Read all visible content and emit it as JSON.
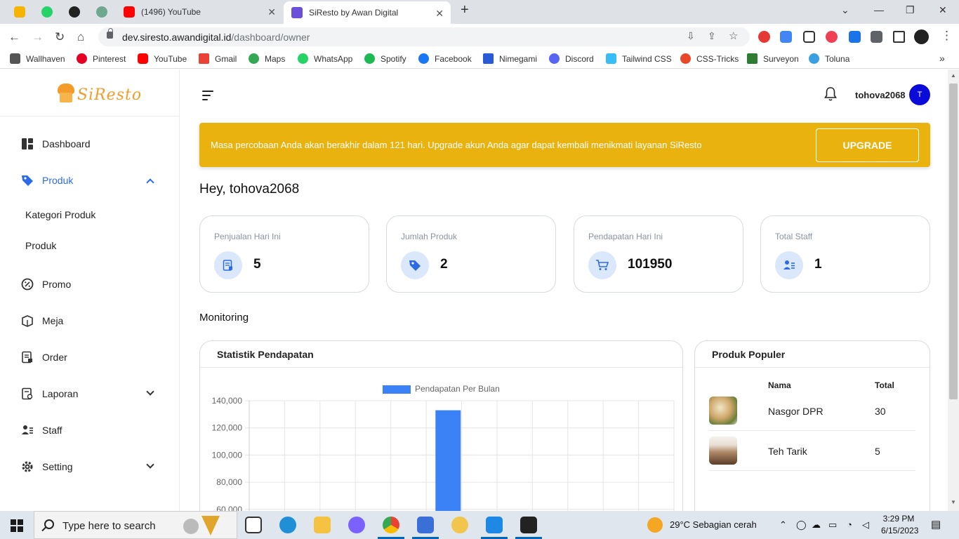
{
  "browser": {
    "tabs": [
      {
        "label": "(1496) YouTube",
        "favicon_color": "#ff0000"
      },
      {
        "label": "SiResto by Awan Digital",
        "favicon_color": "#6b4fd8",
        "active": true
      }
    ],
    "url_host": "dev.siresto.awandigital.id",
    "url_path": "/dashboard/owner",
    "bookmarks": [
      {
        "label": "Wallhaven",
        "icon": "wallhaven-icon",
        "color": "#555555"
      },
      {
        "label": "Pinterest",
        "icon": "pinterest-icon",
        "color": "#e60023"
      },
      {
        "label": "YouTube",
        "icon": "youtube-icon",
        "color": "#ff0000"
      },
      {
        "label": "Gmail",
        "icon": "gmail-icon",
        "color": "#ea4335"
      },
      {
        "label": "Maps",
        "icon": "maps-icon",
        "color": "#34a853"
      },
      {
        "label": "WhatsApp",
        "icon": "whatsapp-icon",
        "color": "#25d366"
      },
      {
        "label": "Spotify",
        "icon": "spotify-icon",
        "color": "#1db954"
      },
      {
        "label": "Facebook",
        "icon": "facebook-icon",
        "color": "#1877f2"
      },
      {
        "label": "Nimegami",
        "icon": "nimegami-icon",
        "color": "#2a5bd7"
      },
      {
        "label": "Discord",
        "icon": "discord-icon",
        "color": "#5865f2"
      },
      {
        "label": "Tailwind CSS",
        "icon": "tailwind-icon",
        "color": "#38bdf8"
      },
      {
        "label": "CSS-Tricks",
        "icon": "css-tricks-icon",
        "color": "#e8472a"
      },
      {
        "label": "Surveyon",
        "icon": "surveyon-icon",
        "color": "#2e7d32"
      },
      {
        "label": "Toluna",
        "icon": "toluna-icon",
        "color": "#3aa0e0"
      }
    ]
  },
  "app": {
    "brand": "SiResto",
    "sidebar": {
      "items": [
        {
          "label": "Dashboard",
          "icon": "dashboard-icon"
        },
        {
          "label": "Produk",
          "icon": "tag-icon",
          "active": true
        },
        {
          "label": "Kategori Produk"
        },
        {
          "label": "Produk"
        },
        {
          "label": "Promo",
          "icon": "percent-icon"
        },
        {
          "label": "Meja",
          "icon": "table-icon"
        },
        {
          "label": "Order",
          "icon": "order-icon"
        },
        {
          "label": "Laporan",
          "icon": "report-icon"
        },
        {
          "label": "Staff",
          "icon": "staff-icon"
        },
        {
          "label": "Setting",
          "icon": "gear-icon"
        }
      ]
    },
    "header": {
      "username": "tohova2068",
      "avatar_initial": "T"
    },
    "banner": {
      "message": "Masa percobaan Anda akan berakhir dalam 121 hari. Upgrade akun Anda agar dapat kembali menikmati layanan SiResto",
      "button": "UPGRADE",
      "color": "#eab20f"
    },
    "greeting": "Hey, tohova2068",
    "stats": [
      {
        "title": "Penjualan Hari Ini",
        "value": "5",
        "icon": "receipt-icon"
      },
      {
        "title": "Jumlah Produk",
        "value": "2",
        "icon": "tag-icon"
      },
      {
        "title": "Pendapatan Hari Ini",
        "value": "101950",
        "icon": "cart-icon"
      },
      {
        "title": "Total Staff",
        "value": "1",
        "icon": "staff-icon"
      }
    ],
    "monitoring_title": "Monitoring",
    "revenue_card": {
      "title": "Statistik Pendapatan"
    },
    "popular_card": {
      "title": "Produk Populer",
      "columns": [
        "Nama",
        "Total"
      ],
      "rows": [
        {
          "name": "Nasgor DPR",
          "total": "30"
        },
        {
          "name": "Teh Tarik",
          "total": "5"
        }
      ]
    }
  },
  "chart_data": {
    "type": "bar",
    "categories": [
      "",
      "",
      "",
      "",
      "",
      "",
      "",
      "",
      "",
      "",
      "",
      ""
    ],
    "series": [
      {
        "name": "Pendapatan Per Bulan",
        "values": [
          0,
          0,
          0,
          0,
          0,
          133000,
          0,
          0,
          0,
          0,
          0,
          0
        ],
        "color": "#3b82f6"
      }
    ],
    "ylim": [
      0,
      140000
    ],
    "yticks_visible": [
      "140,000",
      "120,000",
      "100,000",
      "80,000",
      "60,000"
    ],
    "grid": true,
    "legend": "top-center"
  },
  "taskbar": {
    "search_placeholder": "Type here to search",
    "weather": "29°C  Sebagian cerah",
    "time": "3:29 PM",
    "date": "6/15/2023"
  }
}
